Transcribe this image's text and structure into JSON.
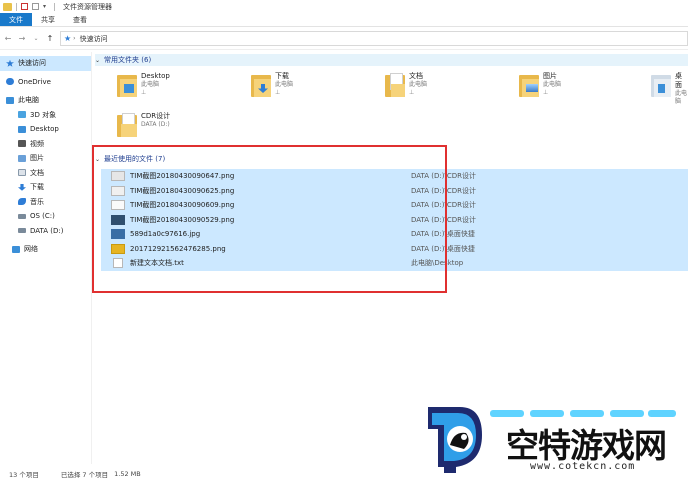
{
  "window": {
    "title": "文件资源管理器"
  },
  "ribbon": {
    "tabs": [
      "文件",
      "共享",
      "查看"
    ]
  },
  "address": {
    "path": "快速访问"
  },
  "sidebar": {
    "items": [
      {
        "label": "快速访问",
        "icon": "star-icon",
        "color": "#2e7dd6"
      },
      {
        "label": "OneDrive",
        "icon": "cloud-icon",
        "color": "#2e7dd6"
      },
      {
        "label": "此电脑",
        "icon": "computer-icon",
        "color": "#3b8fd8"
      },
      {
        "label": "3D 对象",
        "icon": "cube-icon",
        "color": "#4aa3e0"
      },
      {
        "label": "Desktop",
        "icon": "desktop-icon",
        "color": "#3b8fd8"
      },
      {
        "label": "视频",
        "icon": "video-icon",
        "color": "#555555"
      },
      {
        "label": "图片",
        "icon": "picture-icon",
        "color": "#6aa0d8"
      },
      {
        "label": "文档",
        "icon": "document-icon",
        "color": "#8899aa"
      },
      {
        "label": "下载",
        "icon": "download-icon",
        "color": "#2e7dd6"
      },
      {
        "label": "音乐",
        "icon": "music-icon",
        "color": "#2e7dd6"
      },
      {
        "label": "OS (C:)",
        "icon": "drive-icon",
        "color": "#7a8a9a"
      },
      {
        "label": "DATA (D:)",
        "icon": "drive-icon",
        "color": "#7a8a9a"
      },
      {
        "label": "网络",
        "icon": "network-icon",
        "color": "#3b8fd8"
      }
    ]
  },
  "frequent": {
    "header": "常用文件夹 (6)",
    "folders": [
      {
        "name": "Desktop",
        "sub": "此电脑",
        "pin": "📌",
        "badge": "desktop",
        "color": "#3b8fd8"
      },
      {
        "name": "下载",
        "sub": "此电脑",
        "pin": "📌",
        "badge": "download",
        "color": "#2e7dd6"
      },
      {
        "name": "文档",
        "sub": "此电脑",
        "pin": "📌",
        "badge": "document",
        "color": "#ffffff"
      },
      {
        "name": "图片",
        "sub": "此电脑",
        "pin": "📌",
        "badge": "picture",
        "color": "#5aa0e0"
      },
      {
        "name": "桌面",
        "sub": "此电脑",
        "pin": "📌",
        "badge": "desktop",
        "color": "#3b8fd8"
      },
      {
        "name": "CDR设计",
        "sub": "DATA (D:)",
        "pin": "",
        "badge": "none",
        "color": "#ffffff"
      }
    ]
  },
  "recent": {
    "header": "最近使用的文件 (7)",
    "files": [
      {
        "name": "TIM截图20180430090647.png",
        "path": "DATA (D:)\\CDR设计",
        "thumb": "#e6e6e6"
      },
      {
        "name": "TIM截图20180430090625.png",
        "path": "DATA (D:)\\CDR设计",
        "thumb": "#f0f0f0"
      },
      {
        "name": "TIM截图20180430090609.png",
        "path": "DATA (D:)\\CDR设计",
        "thumb": "#fafafa"
      },
      {
        "name": "TIM截图20180430090529.png",
        "path": "DATA (D:)\\CDR设计",
        "thumb": "#2f4f6f"
      },
      {
        "name": "589d1a0c97616.jpg",
        "path": "DATA (D:)\\桌面快捷",
        "thumb": "#3a6ea5"
      },
      {
        "name": "201712921562476285.png",
        "path": "DATA (D:)\\桌面快捷",
        "thumb": "#e6b422"
      },
      {
        "name": "新建文本文档.txt",
        "path": "此电脑\\Desktop",
        "thumb": "#ffffff"
      }
    ]
  },
  "status": {
    "count": "13 个项目",
    "selected": "已选择 7 个项目",
    "size": "1.52 MB"
  },
  "watermark": {
    "name": "空特游戏网",
    "url": "www.cotekcn.com"
  }
}
